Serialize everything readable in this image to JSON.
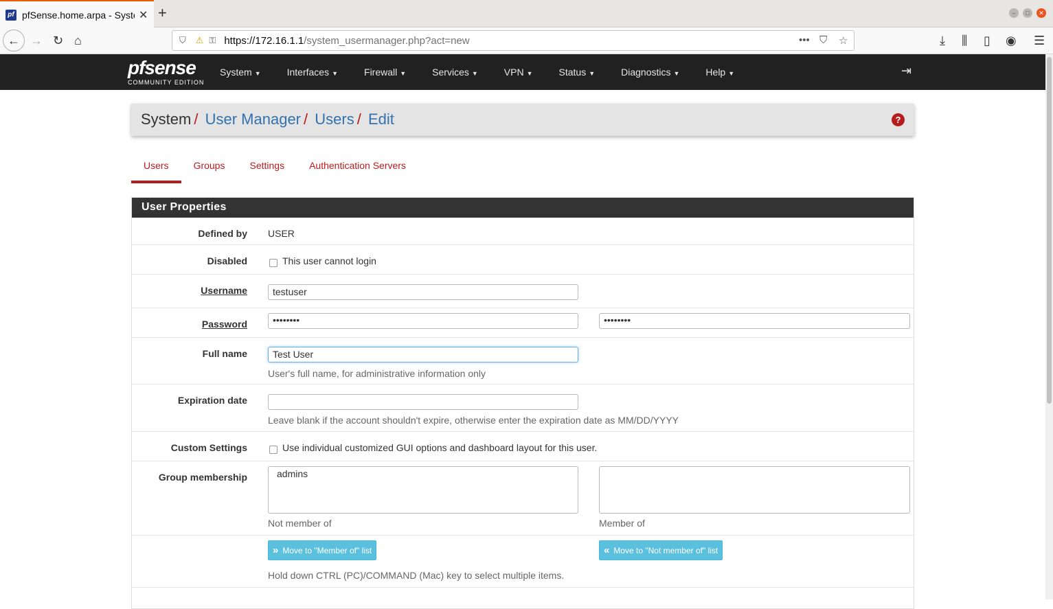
{
  "browser": {
    "tab_title": "pfSense.home.arpa - System: User Manager: Users: Edit",
    "favicon": "pf",
    "url_host": "https://172.16.1.1",
    "url_path": "/system_usermanager.php?act=new"
  },
  "nav": {
    "logo_main": "pfsense",
    "logo_sub": "COMMUNITY EDITION",
    "menu": [
      {
        "label": "System"
      },
      {
        "label": "Interfaces"
      },
      {
        "label": "Firewall"
      },
      {
        "label": "Services"
      },
      {
        "label": "VPN"
      },
      {
        "label": "Status"
      },
      {
        "label": "Diagnostics"
      },
      {
        "label": "Help"
      }
    ]
  },
  "breadcrumb": {
    "root": "System",
    "items": [
      "User Manager",
      "Users",
      "Edit"
    ],
    "sep": "/"
  },
  "tabs": [
    "Users",
    "Groups",
    "Settings",
    "Authentication Servers"
  ],
  "panel": {
    "title": "User Properties",
    "defined_by_label": "Defined by",
    "defined_by_value": "USER",
    "disabled_label": "Disabled",
    "disabled_text": "This user cannot login",
    "username_label": "Username",
    "username_value": "testuser",
    "password_label": "Password",
    "password_value": "••••••••",
    "password_confirm_value": "••••••••",
    "fullname_label": "Full name",
    "fullname_value": "Test User",
    "fullname_help": "User's full name, for administrative information only",
    "expiration_label": "Expiration date",
    "expiration_value": "",
    "expiration_help": "Leave blank if the account shouldn't expire, otherwise enter the expiration date as MM/DD/YYYY",
    "custom_label": "Custom Settings",
    "custom_text": "Use individual customized GUI options and dashboard layout for this user.",
    "group_label": "Group membership",
    "not_member_items": [
      "admins"
    ],
    "not_member_caption": "Not member of",
    "member_caption": "Member of",
    "move_to_member": "Move to \"Member of\" list",
    "move_to_not_member": "Move to \"Not member of\" list",
    "multi_help": "Hold down CTRL (PC)/COMMAND (Mac) key to select multiple items."
  }
}
